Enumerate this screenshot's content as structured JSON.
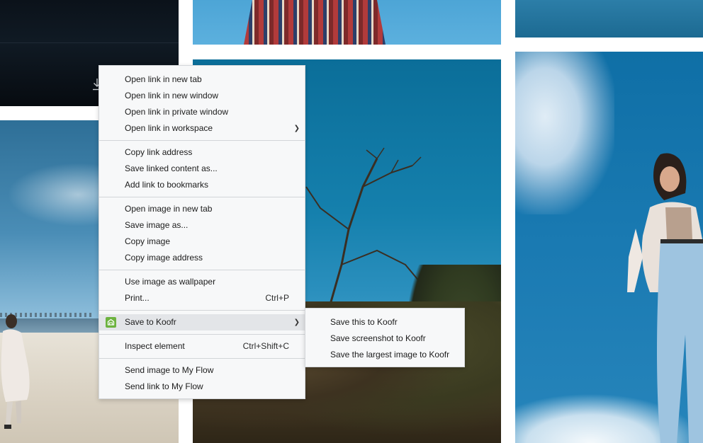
{
  "context_menu": {
    "groups": [
      [
        {
          "label": "Open link in new tab"
        },
        {
          "label": "Open link in new window"
        },
        {
          "label": "Open link in private window"
        },
        {
          "label": "Open link in workspace",
          "has_submenu": true
        }
      ],
      [
        {
          "label": "Copy link address"
        },
        {
          "label": "Save linked content as..."
        },
        {
          "label": "Add link to bookmarks"
        }
      ],
      [
        {
          "label": "Open image in new tab"
        },
        {
          "label": "Save image as..."
        },
        {
          "label": "Copy image"
        },
        {
          "label": "Copy image address"
        }
      ],
      [
        {
          "label": "Use image as wallpaper"
        },
        {
          "label": "Print...",
          "shortcut": "Ctrl+P"
        }
      ],
      [
        {
          "label": "Save to Koofr",
          "has_submenu": true,
          "icon": "koofr-icon",
          "highlighted": true
        }
      ],
      [
        {
          "label": "Inspect element",
          "shortcut": "Ctrl+Shift+C"
        }
      ],
      [
        {
          "label": "Send image to My Flow"
        },
        {
          "label": "Send link to My Flow"
        }
      ]
    ]
  },
  "koofr_submenu": {
    "items": [
      {
        "label": "Save this to Koofr"
      },
      {
        "label": "Save screenshot to Koofr"
      },
      {
        "label": "Save the largest image to Koofr"
      }
    ]
  },
  "colors": {
    "menu_bg": "#f7f8f9",
    "menu_highlight": "#e3e5e8",
    "koofr_green": "#6db33f"
  },
  "icons": {
    "download": "download-icon",
    "submenu_arrow": "chevron-right-icon",
    "koofr": "koofr-icon"
  }
}
